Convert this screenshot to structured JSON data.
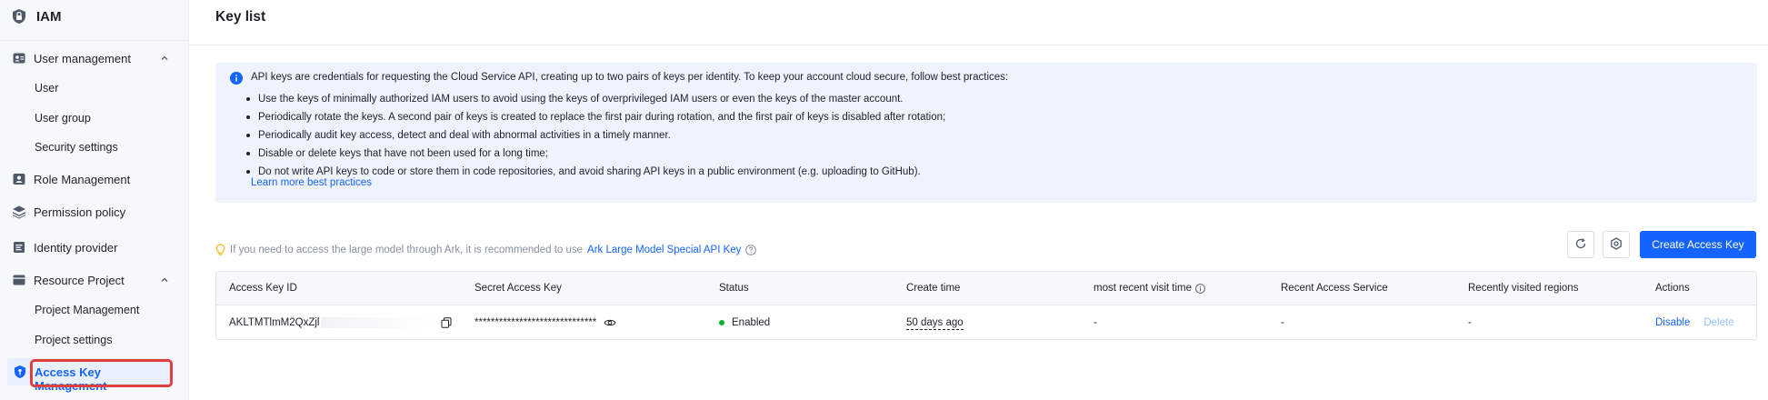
{
  "sidebar": {
    "brand": "IAM",
    "items": [
      {
        "label": "User management",
        "icon": "user-management-icon",
        "expanded": true
      },
      {
        "label": "User"
      },
      {
        "label": "User group"
      },
      {
        "label": "Security settings"
      },
      {
        "label": "Role Management",
        "icon": "role-icon"
      },
      {
        "label": "Permission policy",
        "icon": "layers-icon"
      },
      {
        "label": "Identity provider",
        "icon": "id-card-icon"
      },
      {
        "label": "Resource Project",
        "icon": "folder-icon",
        "expanded": true
      },
      {
        "label": "Project Management"
      },
      {
        "label": "Project settings"
      },
      {
        "label": "Access Key Management",
        "icon": "shield-key-icon",
        "active": true
      }
    ]
  },
  "header": {
    "title": "Key list"
  },
  "info": {
    "intro": "API keys are credentials for requesting the Cloud Service API, creating up to two pairs of keys per identity. To keep your account cloud secure, follow best practices:",
    "bullets": [
      "Use the keys of minimally authorized IAM users to avoid using the keys of overprivileged IAM users or even the keys of the master account.",
      "Periodically rotate the keys. A second pair of keys is created to replace the first pair during rotation, and the first pair of keys is disabled after rotation;",
      "Periodically audit key access, detect and deal with abnormal activities in a timely manner.",
      "Disable or delete keys that have not been used for a long time;",
      "Do not write API keys to code or store them in code repositories, and avoid sharing API keys in a public environment (e.g. uploading to GitHub)."
    ],
    "learn_more": "Learn more best practices"
  },
  "hint": {
    "text": "If you need to access the large model through Ark, it is recommended to use",
    "link": "Ark Large Model Special API Key"
  },
  "toolbar": {
    "create_label": "Create Access Key"
  },
  "table": {
    "columns": [
      "Access Key ID",
      "Secret Access Key",
      "Status",
      "Create time",
      "most recent visit time",
      "Recent Access Service",
      "Recently visited regions",
      "Actions"
    ],
    "rows": [
      {
        "access_key_id": "AKLTMTlmM2QxZjl",
        "secret": "******************************",
        "status": "Enabled",
        "create_time": "50 days ago",
        "recent_visit": "-",
        "recent_service": "-",
        "recent_regions": "-",
        "actions": [
          "Disable",
          "Delete"
        ]
      }
    ]
  },
  "colors": {
    "accent": "#1664ff",
    "status_enabled": "#00b42a",
    "highlight": "#e0403d"
  }
}
